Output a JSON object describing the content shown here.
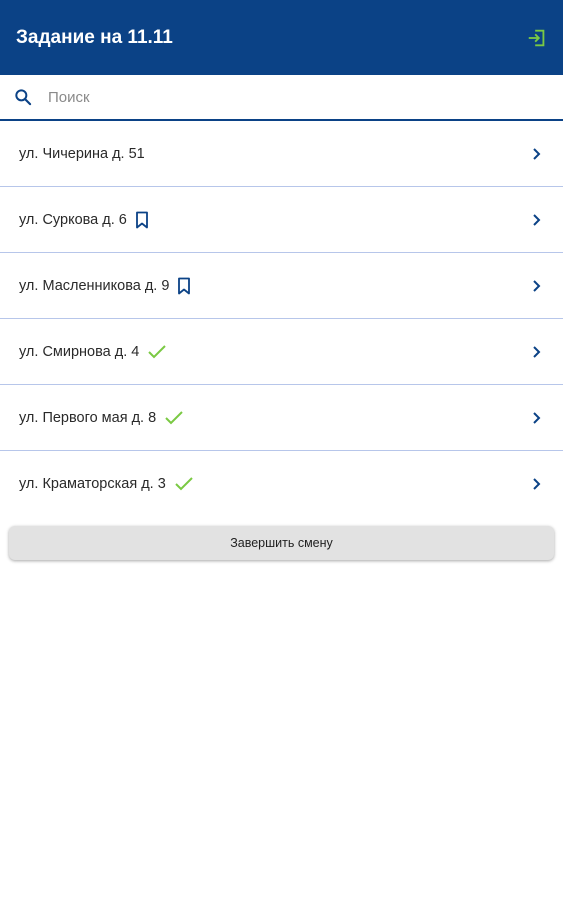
{
  "header": {
    "title": "Задание на 11.11",
    "exit_icon": "exit-icon",
    "background_color": "#0b4286",
    "exit_icon_color": "#7ac943"
  },
  "search": {
    "placeholder": "Поиск",
    "value": "",
    "icon": "search-icon"
  },
  "addresses": [
    {
      "label": "ул. Чичерина д. 51",
      "status": "none"
    },
    {
      "label": "ул. Суркова д. 6",
      "status": "bookmark"
    },
    {
      "label": "ул. Масленникова д. 9",
      "status": "bookmark"
    },
    {
      "label": "ул. Смирнова д. 4",
      "status": "done"
    },
    {
      "label": "ул. Первого мая д. 8",
      "status": "done"
    },
    {
      "label": "ул. Краматорская д. 3",
      "status": "done"
    }
  ],
  "colors": {
    "accent": "#0b4286",
    "done": "#7ac943",
    "divider": "#b7c6ea"
  },
  "footer": {
    "finish_label": "Завершить смену"
  }
}
